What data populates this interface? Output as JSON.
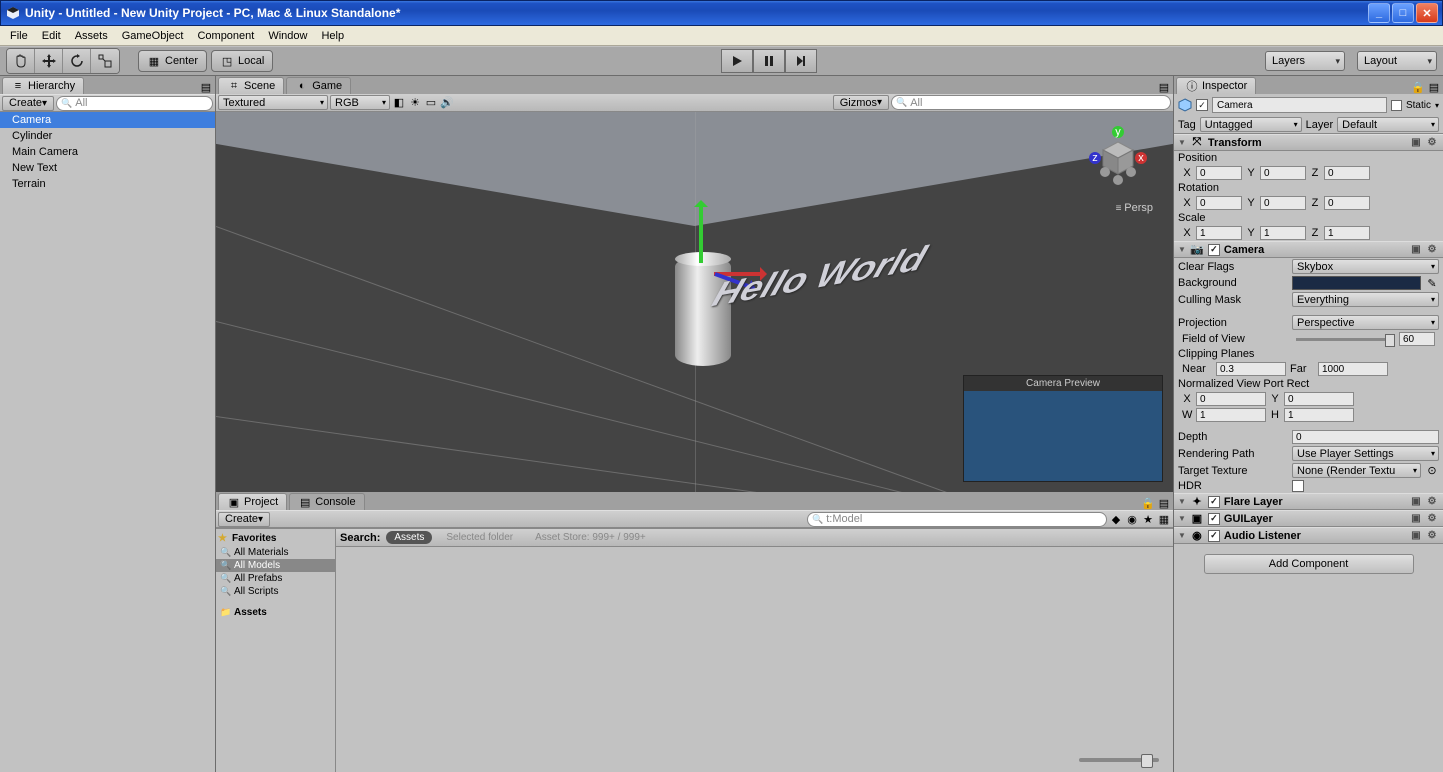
{
  "window": {
    "title": "Unity - Untitled - New Unity Project - PC, Mac & Linux Standalone*"
  },
  "menubar": [
    "File",
    "Edit",
    "Assets",
    "GameObject",
    "Component",
    "Window",
    "Help"
  ],
  "toolbar": {
    "center": "Center",
    "local": "Local",
    "layers": "Layers",
    "layout": "Layout"
  },
  "hierarchy": {
    "tab": "Hierarchy",
    "create": "Create",
    "search_placeholder": "All",
    "items": [
      "Camera",
      "Cylinder",
      "Main Camera",
      "New Text",
      "Terrain"
    ],
    "selected": 0
  },
  "scene": {
    "tab_scene": "Scene",
    "tab_game": "Game",
    "shading": "Textured",
    "render": "RGB",
    "gizmos": "Gizmos",
    "search_placeholder": "All",
    "persp": "Persp",
    "text3d": "Hello World",
    "preview_title": "Camera Preview"
  },
  "project": {
    "tab_project": "Project",
    "tab_console": "Console",
    "create": "Create",
    "search_value": "t:Model",
    "favorites": "Favorites",
    "fav_items": [
      "All Materials",
      "All Models",
      "All Prefabs",
      "All Scripts"
    ],
    "fav_selected": 1,
    "assets": "Assets",
    "search_label": "Search:",
    "chip_assets": "Assets",
    "chip_folder": "Selected folder",
    "chip_store": "Asset Store: 999+ / 999+"
  },
  "inspector": {
    "tab": "Inspector",
    "name": "Camera",
    "static": "Static",
    "tag_label": "Tag",
    "tag_value": "Untagged",
    "layer_label": "Layer",
    "layer_value": "Default",
    "transform": {
      "title": "Transform",
      "position": "Position",
      "px": "0",
      "py": "0",
      "pz": "0",
      "rotation": "Rotation",
      "rx": "0",
      "ry": "0",
      "rz": "0",
      "scale": "Scale",
      "sx": "1",
      "sy": "1",
      "sz": "1"
    },
    "camera": {
      "title": "Camera",
      "clear_flags": "Clear Flags",
      "clear_flags_v": "Skybox",
      "background": "Background",
      "culling": "Culling Mask",
      "culling_v": "Everything",
      "projection": "Projection",
      "projection_v": "Perspective",
      "fov": "Field of View",
      "fov_v": "60",
      "clipping": "Clipping Planes",
      "near": "Near",
      "near_v": "0.3",
      "far": "Far",
      "far_v": "1000",
      "viewport": "Normalized View Port Rect",
      "vx": "0",
      "vy": "0",
      "vw": "1",
      "vh": "1",
      "depth": "Depth",
      "depth_v": "0",
      "rendering": "Rendering Path",
      "rendering_v": "Use Player Settings",
      "target": "Target Texture",
      "target_v": "None (Render Textu",
      "hdr": "HDR"
    },
    "flare": "Flare Layer",
    "guilayer": "GUILayer",
    "audio": "Audio Listener",
    "add": "Add Component"
  }
}
